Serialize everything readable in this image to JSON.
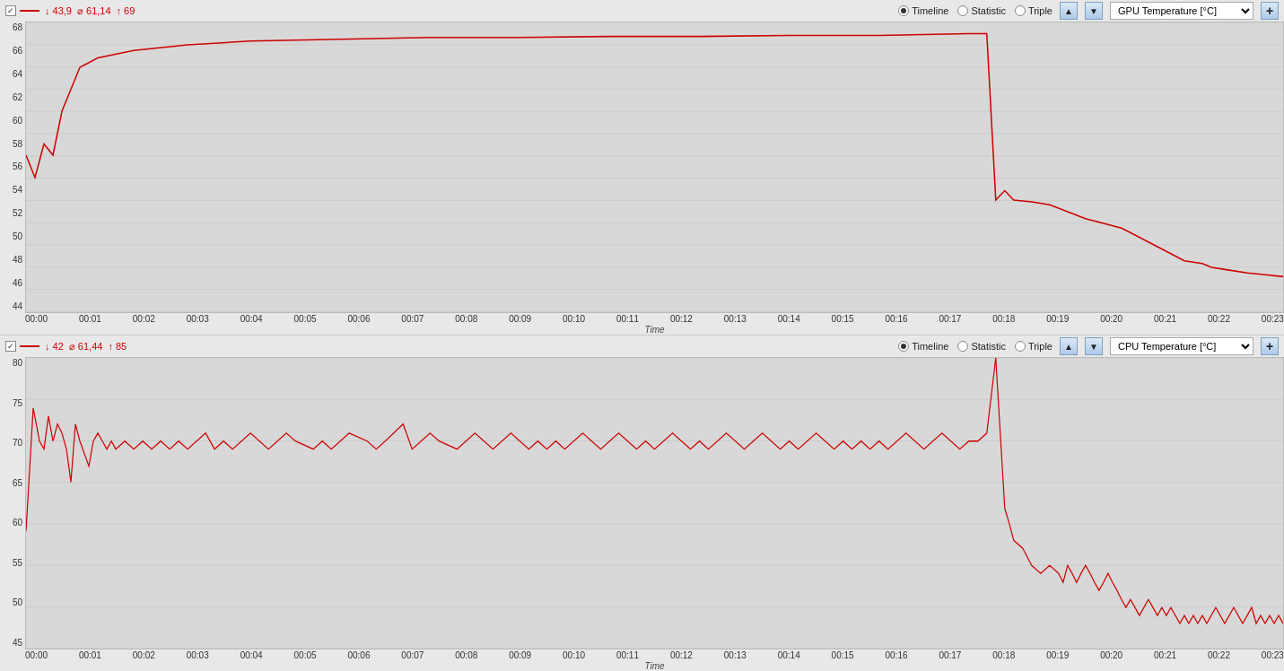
{
  "chart1": {
    "checkbox": true,
    "min_label": "↓ 43,9",
    "avg_label": "⌀ 61,14",
    "max_label": "↑ 69",
    "mode_timeline": "Timeline",
    "mode_statistic": "Statistic",
    "mode_triple": "Triple",
    "dropdown_value": "GPU Temperature [°C]",
    "y_labels": [
      "68",
      "66",
      "64",
      "62",
      "60",
      "58",
      "56",
      "54",
      "52",
      "50",
      "48",
      "46",
      "44"
    ],
    "x_labels": [
      "00:00",
      "00:01",
      "00:02",
      "00:03",
      "00:04",
      "00:05",
      "00:06",
      "00:07",
      "00:08",
      "00:09",
      "00:10",
      "00:11",
      "00:12",
      "00:13",
      "00:14",
      "00:15",
      "00:16",
      "00:17",
      "00:18",
      "00:19",
      "00:20",
      "00:21",
      "00:22",
      "00:23"
    ],
    "x_axis_title": "Time"
  },
  "chart2": {
    "checkbox": true,
    "min_label": "↓ 42",
    "avg_label": "⌀ 61,44",
    "max_label": "↑ 85",
    "mode_timeline": "Timeline",
    "mode_statistic": "Statistic",
    "mode_triple": "Triple",
    "dropdown_value": "CPU Temperature [°C]",
    "y_labels": [
      "80",
      "75",
      "70",
      "65",
      "60",
      "55",
      "50",
      "45"
    ],
    "x_labels": [
      "00:00",
      "00:01",
      "00:02",
      "00:03",
      "00:04",
      "00:05",
      "00:06",
      "00:07",
      "00:08",
      "00:09",
      "00:10",
      "00:11",
      "00:12",
      "00:13",
      "00:14",
      "00:15",
      "00:16",
      "00:17",
      "00:18",
      "00:19",
      "00:20",
      "00:21",
      "00:22",
      "00:23"
    ],
    "x_axis_title": "Time"
  }
}
